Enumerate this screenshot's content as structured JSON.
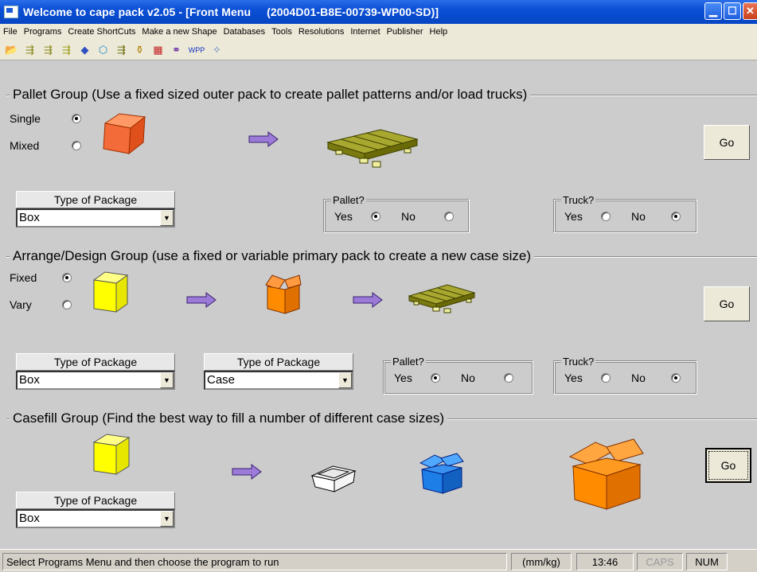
{
  "window": {
    "title": "Welcome to cape pack v2.05 - [Front Menu     (2004D01-B8E-00739-WP00-SD)]"
  },
  "menu": [
    "File",
    "Programs",
    "Create ShortCuts",
    "Make a new Shape",
    "Databases",
    "Tools",
    "Resolutions",
    "Internet",
    "Publisher",
    "Help"
  ],
  "toolbar_icons": [
    "open-folder-icon",
    "pallet-tool-icon",
    "arrange-tool-icon",
    "design-tool-icon",
    "casefill-tool-icon",
    "box-tool-icon",
    "load-tool-icon",
    "bottle-tool-icon",
    "truck-tool-icon",
    "link-tool-icon",
    "wpp-icon",
    "wand-icon"
  ],
  "toolbar_wpp_label": "WPP",
  "pallet_group": {
    "title": "Pallet Group (Use a fixed sized outer pack to create pallet patterns and/or load trucks)",
    "single_label": "Single",
    "mixed_label": "Mixed",
    "go_label": "Go",
    "package_header": "Type of Package",
    "package_value": "Box",
    "pallet_title": "Pallet?",
    "truck_title": "Truck?",
    "yes": "Yes",
    "no": "No"
  },
  "arrange_group": {
    "title": "Arrange/Design Group (use a fixed or variable primary pack to create a new case size)",
    "fixed_label": "Fixed",
    "vary_label": "Vary",
    "go_label": "Go",
    "package_header_1": "Type of Package",
    "package_value_1": "Box",
    "package_header_2": "Type of Package",
    "package_value_2": "Case",
    "pallet_title": "Pallet?",
    "truck_title": "Truck?",
    "yes": "Yes",
    "no": "No"
  },
  "casefill_group": {
    "title": "Casefill Group (Find the best way to fill a number of different case sizes)",
    "go_label": "Go",
    "package_header": "Type of Package",
    "package_value": "Box"
  },
  "status": {
    "message": "Select Programs Menu and then choose the program to run",
    "units": "(mm/kg)",
    "time": "13:46",
    "caps": "CAPS",
    "num": "NUM"
  },
  "colors": {
    "box_orange": "#f26b38",
    "box_yellow": "#ffff00",
    "arrow_purple": "#9b7ad8",
    "pallet_olive": "#8a8a1a",
    "case_blue": "#1e7ee8",
    "case_orange": "#ff8c00"
  }
}
